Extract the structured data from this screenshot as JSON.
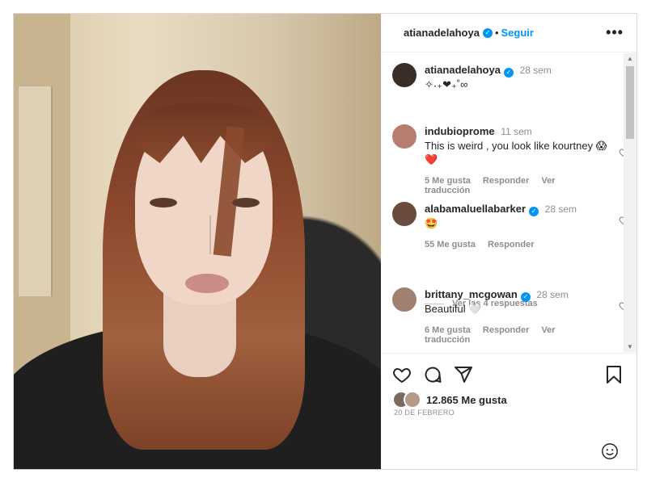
{
  "header": {
    "username": "atianadelahoya",
    "separator": "•",
    "follow_label": "Seguir",
    "more_label": "•••"
  },
  "caption": {
    "username": "atianadelahoya",
    "time": "28 sem",
    "text": "✧˖₊❤︎₊˚∞"
  },
  "comments": [
    {
      "username": "indubioprome",
      "time": "11 sem",
      "text": "This is weird , you look like kourtney 😱❤️",
      "likes": "5 Me gusta",
      "reply": "Responder",
      "translate": "Ver traducción",
      "avatar_color": "#b77d6e"
    },
    {
      "username": "alabamaluellabarker",
      "verified": true,
      "time": "28 sem",
      "text": "🤩",
      "likes": "55 Me gusta",
      "reply": "Responder",
      "avatar_color": "#6b4b3d"
    },
    {
      "username": "brittany_mcgowan",
      "verified": true,
      "time": "28 sem",
      "text": "Beautiful 🤍",
      "likes": "6 Me gusta",
      "reply": "Responder",
      "translate": "Ver traducción",
      "avatar_color": "#a0806e"
    }
  ],
  "view_replies": "Ver las 4 respuestas",
  "footer": {
    "likes": "12.865 Me gusta",
    "date": "20 DE FEBRERO"
  },
  "colors": {
    "accent": "#0095f6",
    "muted": "#8e8e8e"
  }
}
